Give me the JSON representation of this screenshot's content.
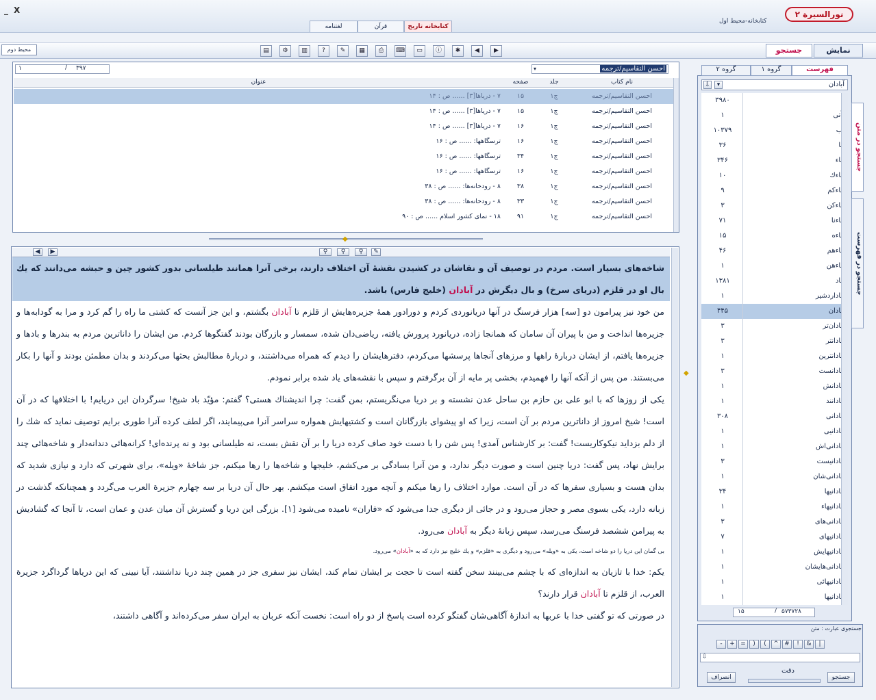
{
  "window": {
    "minimize": "_",
    "close": "X"
  },
  "app": {
    "logo": "نورالسيرة ۲",
    "library_label": "کتابخانه-محیط اول"
  },
  "top_tabs": [
    {
      "label": "کتابخانه تاریخ",
      "active": true
    },
    {
      "label": "قرآن",
      "active": false
    },
    {
      "label": "لغتنامه",
      "active": false
    }
  ],
  "toolbar": {
    "env2_label": "محیط دوم",
    "icons": [
      "grid-icon",
      "tools-icon",
      "book-icon",
      "help-icon",
      "edit-icon",
      "page-icon",
      "print-icon",
      "keyboard-icon",
      "doc-icon",
      "info-icon",
      "settings-icon",
      "prev-icon",
      "next-icon"
    ],
    "icon_glyphs": [
      "▤",
      "⚙",
      "▥",
      "?",
      "✎",
      "▦",
      "⎙",
      "⌨",
      "▭",
      "ⓘ",
      "✱",
      "◀",
      "▶"
    ]
  },
  "view_tabs": {
    "display": "نمایش",
    "search": "جستجو"
  },
  "results": {
    "page_current": "۱",
    "page_total": "۳۹۷",
    "book_selector": "احسن التقاسیم/ترجمه",
    "columns": {
      "title": "عنوان",
      "page": "صفحه",
      "volume": "جلد",
      "book": "نام کتاب"
    },
    "rows": [
      {
        "book": "احسن التقاسیم/ترجمه",
        "vol": "ج۱",
        "page": "۱۵",
        "title": "۷ - دریاها[۳] ...... ص : ۱۴",
        "selected": true
      },
      {
        "book": "احسن التقاسیم/ترجمه",
        "vol": "ج۱",
        "page": "۱۵",
        "title": "۷ - دریاها[۳] ...... ص : ۱۴",
        "selected": false
      },
      {
        "book": "احسن التقاسیم/ترجمه",
        "vol": "ج۱",
        "page": "۱۶",
        "title": "۷ - دریاها[۳] ...... ص : ۱۴",
        "selected": false
      },
      {
        "book": "احسن التقاسیم/ترجمه",
        "vol": "ج۱",
        "page": "۱۶",
        "title": "ترسگاهها: ...... ص : ۱۶",
        "selected": false
      },
      {
        "book": "احسن التقاسیم/ترجمه",
        "vol": "ج۱",
        "page": "۳۴",
        "title": "ترسگاهها: ...... ص : ۱۶",
        "selected": false
      },
      {
        "book": "احسن التقاسیم/ترجمه",
        "vol": "ج۱",
        "page": "۱۶",
        "title": "ترسگاهها: ...... ص : ۱۶",
        "selected": false
      },
      {
        "book": "احسن التقاسیم/ترجمه",
        "vol": "ج۱",
        "page": "۳۸",
        "title": "۸ - رودخانه‌ها: ...... ص : ۳۸",
        "selected": false
      },
      {
        "book": "احسن التقاسیم/ترجمه",
        "vol": "ج۱",
        "page": "۳۳",
        "title": "۸ - رودخانه‌ها: ...... ص : ۳۸",
        "selected": false
      },
      {
        "book": "احسن التقاسیم/ترجمه",
        "vol": "ج۱",
        "page": "۹۱",
        "title": "۱۸ - نمای کشور اسلام ...... ص : ۹۰",
        "selected": false
      }
    ]
  },
  "text": {
    "paragraphs": [
      {
        "highlighted": true,
        "parts": [
          "شاخه‌های بسیار است. مردم در توصیف آن و نقاشان در کشیدن نقشهٔ آن اختلاف دارند، برخی آنرا همانند طیلسانی بدور کشور چین و حبشه می‌دانند که یك بال او در قلزم (دریای سرخ) و بال دیگرش در ",
          "آبادان",
          " (خلیج فارس) باشد."
        ]
      },
      {
        "highlighted": false,
        "parts": [
          "من خود نیز پیرامون دو [سه] هزار فرسنگ در آنها دریانوردی کردم و دورادور همهٔ جزیره‌هایش از قلزم تا ",
          "آبادان",
          " بگشتم، و این جز آنست که کشتی ما راه را گم کرد و مرا به گودابه‌ها و جزیره‌ها انداخت و من با پیران آن سامان که همانجا زاده، دریانورد پرورش یافته، ریاضی‌دان شده، سمسار و بازرگان بودند گفتگوها کردم. من ایشان را داناترین مردم به بندرها و بادها و جزیره‌ها یافتم، از ایشان دربارهٔ راهها و مرزهای آنجاها پرسشها می‌کردم، دفترهایشان را دیدم که همراه می‌داشتند، و دربارهٔ مطالبش بحثها می‌کردند و بدان مطمئن بودند و آنها را بکار می‌بستند. من پس از آنکه آنها را فهمیدم، بخشی پر مایه از آن برگرفتم و سپس با نقشه‌های یاد شده برابر نمودم."
        ]
      },
      {
        "highlighted": false,
        "parts": [
          "یکی از روزها که با ابو علی بن حازم بن ساحل عدن نشسته و بر دریا می‌نگریستم، بمن گفت: چرا اندیشناك هستی؟ گفتم: مؤیّد باد شیخ! سرگردان این دریایم! با اختلافها که در آن است! شیخ امروز از داناترین مردم بر آن است، زیرا که او پیشوای بازرگانان است و کشتیهایش همواره سراسر آنرا می‌پیمایند، اگر لطف کرده آنرا طوری برایم توصیف نماید که شك را از دلم بزداید نیکوکاریست! گفت: بر کارشناس آمدی! پس شن را با دست خود صاف کرده دریا را بر آن نقش بست، نه طیلسانی بود و نه پرنده‌ای! کرانه‌هائی دندانه‌دار و شاخه‌هائی چند برایش نهاد، پس گفت: دریا چنین است و صورت دیگر ندارد، و من آنرا بسادگی بر می‌کشم، خلیجها و شاخه‌ها را رها میکنم، جز شاخهٔ «ویله»، برای شهرتی که دارد و نیازی شدید که بدان هست و بسیاری سفرها که در آن است. موارد اختلاف را رها میکنم و آنچه مورد اتفاق است میکشم. بهر حال آن دریا بر سه چهارم جزیرة العرب می‌گردد و همچنانکه گذشت در زبانه دارد، یکی بسوی مصر و حجاز می‌رود و در جائی از دیگری جدا می‌شود که «فاران» نامیده می‌شود [۱]. بزرگی این دریا و گسترش آن میان عدن و عمان است، تا آنجا که گشادیش به پیرامن ششصد فرسنگ می‌رسد، سپس زبانهٔ دیگر به ",
          "آبادان",
          " می‌رود."
        ]
      }
    ],
    "footnote": [
      "بی گمان این دریا را دو شاخه است، یکی به «ویله» می‌رود و دیگری به «قلزم» و یك خلیج نیز دارد که به «",
      "آبادان",
      "» می‌رود."
    ],
    "paragraphs2": [
      {
        "parts": [
          "یکم: خدا با تازیان به اندازه‌ای که با چشم می‌بینند سخن گفته است تا حجت بر ایشان تمام کند، ایشان نیز سفری جز در همین چند دریا نداشتند، آیا نبینی که این دریاها گرداگرد جزیرة العرب، از قلزم تا ",
          "آبادان",
          " قرار دارند؟"
        ]
      },
      {
        "parts": [
          "در صورتی که تو گفتی خدا با عربها به اندازهٔ آگاهی‌شان گفتگو کرده است پاسخ از دو راه است: نخست آنکه عربان به ایران سفر می‌کرده‌اند و آگاهی داشتند،"
        ]
      }
    ]
  },
  "index": {
    "tabs": [
      {
        "label": "فهرست",
        "active": true
      },
      {
        "label": "گروه ۱",
        "active": false
      },
      {
        "label": "گروه ۲",
        "active": false
      }
    ],
    "search_value": "آبادان",
    "items": [
      {
        "word": "آ",
        "count": "۳۹۸۰"
      },
      {
        "word": "آآتی",
        "count": "۱"
      },
      {
        "word": "آب",
        "count": "۱۰۳۷۹"
      },
      {
        "word": "آبا",
        "count": "۳۶"
      },
      {
        "word": "آباء",
        "count": "۳۴۶"
      },
      {
        "word": "آباءك",
        "count": "۱۰"
      },
      {
        "word": "آباءكم",
        "count": "۹"
      },
      {
        "word": "آباءكن",
        "count": "۳"
      },
      {
        "word": "آباءنا",
        "count": "۷۱"
      },
      {
        "word": "آباءه",
        "count": "۱۵"
      },
      {
        "word": "آباءهم",
        "count": "۴۶"
      },
      {
        "word": "آباءهن",
        "count": "۱"
      },
      {
        "word": "آباد",
        "count": "۱۳۸۱"
      },
      {
        "word": "آباداردشیر",
        "count": "۱"
      },
      {
        "word": "آبادان",
        "count": "۴۴۵",
        "selected": true
      },
      {
        "word": "آبادان‌تر",
        "count": "۳"
      },
      {
        "word": "آبادانتر",
        "count": "۳"
      },
      {
        "word": "آبادانترین",
        "count": "۱"
      },
      {
        "word": "آبادانست",
        "count": "۳"
      },
      {
        "word": "آبادانش",
        "count": "۱"
      },
      {
        "word": "آبادانند",
        "count": "۱"
      },
      {
        "word": "آبادانی",
        "count": "۳۰۸"
      },
      {
        "word": "آبادانیی",
        "count": "۱"
      },
      {
        "word": "آبادانی‌اش",
        "count": "۱"
      },
      {
        "word": "آبادانیست",
        "count": "۳"
      },
      {
        "word": "آبادانی‌شان",
        "count": "۱"
      },
      {
        "word": "آبادانیها",
        "count": "۳۴"
      },
      {
        "word": "آبادانیهاء",
        "count": "۱"
      },
      {
        "word": "آبادانی‌های",
        "count": "۳"
      },
      {
        "word": "آبادانیهای",
        "count": "۷"
      },
      {
        "word": "آبادانیهایش",
        "count": "۱"
      },
      {
        "word": "آبادانی‌هایشان",
        "count": "۱"
      },
      {
        "word": "آبادانیهائی",
        "count": "۱"
      },
      {
        "word": "آبادانیها",
        "count": "۱"
      }
    ],
    "page_current": "۱۵",
    "page_total": "۵۷۳۷۲۸"
  },
  "side_tabs": {
    "search_in_text": "جستجو در متن",
    "search_in_index": "جستجو در فهرست"
  },
  "phrase_search": {
    "title": "جستجوی عبارت : متن",
    "operators": [
      "-",
      "+",
      "=",
      "(",
      ")",
      "^",
      "#",
      "!",
      "&",
      "|"
    ],
    "precision_label": "دقت",
    "search_button": "جستجو",
    "cancel_button": "انصراف"
  }
}
